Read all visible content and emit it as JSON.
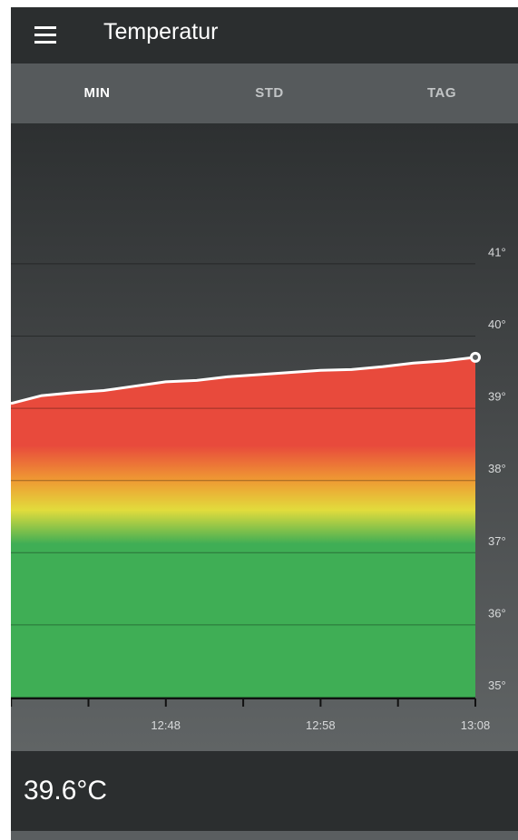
{
  "appbar": {
    "menu_icon": "hamburger-menu-icon",
    "title": "Temperatur"
  },
  "tabs": [
    {
      "label": "MIN",
      "active": true
    },
    {
      "label": "STD",
      "active": false
    },
    {
      "label": "TAG",
      "active": false
    }
  ],
  "colors": {
    "appbar": "#2b2e2f",
    "tabbar": "#565a5c",
    "hot": "#e84a3c",
    "warm": "#ef9833",
    "mild": "#e2dc3c",
    "cool": "#3fae55",
    "line": "#ffffff"
  },
  "chart_data": {
    "type": "area",
    "y_tick_labels": [
      "35°",
      "36°",
      "37°",
      "38°",
      "39°",
      "40°",
      "41°"
    ],
    "y_ticks": [
      35,
      36,
      37,
      38,
      39,
      40,
      41
    ],
    "ylim": [
      35,
      42
    ],
    "x_tick_labels": [
      "12:48",
      "12:58",
      "13:08"
    ],
    "x_minutes_visible": [
      -6,
      0
    ],
    "series": [
      {
        "x": [
          "12:38",
          "12:40",
          "12:42",
          "12:44",
          "12:46",
          "12:48",
          "12:50",
          "12:52",
          "12:54",
          "12:56",
          "12:58",
          "13:00",
          "13:02",
          "13:04",
          "13:06",
          "13:08"
        ],
        "values": [
          39.06,
          39.17,
          39.21,
          39.24,
          39.3,
          39.36,
          39.38,
          39.43,
          39.46,
          39.49,
          39.52,
          39.53,
          39.57,
          39.62,
          39.65,
          39.7
        ]
      }
    ],
    "grid": true
  },
  "readout": {
    "value": "39.6°C"
  }
}
